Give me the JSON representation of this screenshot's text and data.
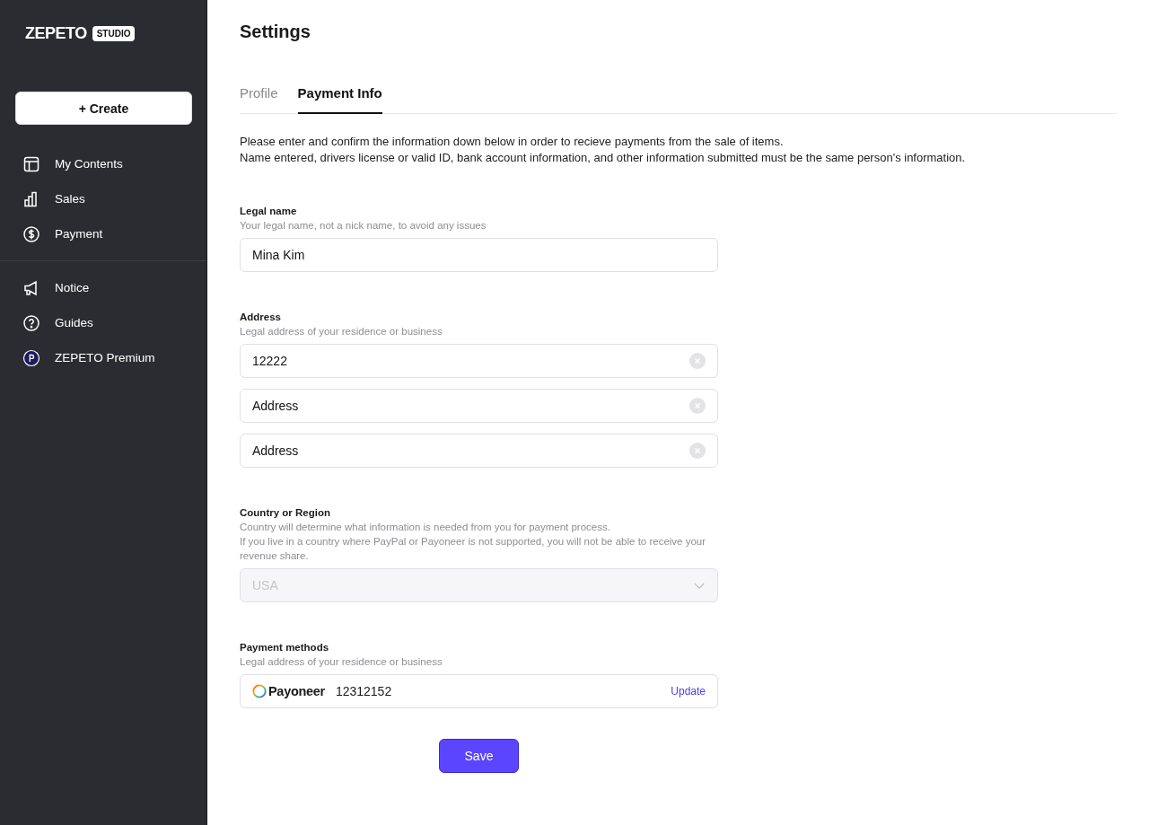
{
  "sidebar": {
    "logo": {
      "wordmark": "ZEPETO",
      "badge": "STUDIO"
    },
    "create_button": "+ Create",
    "groups": [
      [
        {
          "kind": "contents",
          "label": "My Contents"
        },
        {
          "kind": "sales",
          "label": "Sales"
        },
        {
          "kind": "payment",
          "label": "Payment"
        }
      ],
      [
        {
          "kind": "notice",
          "label": "Notice"
        },
        {
          "kind": "guides",
          "label": "Guides"
        },
        {
          "kind": "premium",
          "label": "ZEPETO Premium"
        }
      ]
    ]
  },
  "page": {
    "title": "Settings",
    "tabs": [
      {
        "label": "Profile",
        "selected": false
      },
      {
        "label": "Payment Info",
        "selected": true
      }
    ],
    "intro": [
      "Please enter and confirm the information down below in order to recieve payments from the sale of items.",
      "Name entered, drivers license or valid ID, bank account information, and other information submitted must be the same person's information."
    ],
    "legal_name": {
      "label": "Legal name",
      "hint": [
        "Your legal name, not a nick name, to avoid any issues"
      ],
      "value": "Mina Kim"
    },
    "address": {
      "label": "Address",
      "hint": [
        "Legal address of your residence or business"
      ],
      "fields": [
        {
          "value": "12222"
        },
        {
          "placeholder": "Address"
        },
        {
          "placeholder": "Address"
        }
      ]
    },
    "country": {
      "label": "Country or Region",
      "hint": [
        "Country will determine what information is needed from you for payment process.",
        "If you live in a country where PayPal or Payoneer is not supported, you will not be able to receive your revenue share."
      ],
      "value": "USA",
      "disabled": true
    },
    "payment_methods": {
      "label": "Payment methods",
      "hint": [
        "Legal address of your residence or business"
      ],
      "provider": "Payoneer",
      "account": "12312152",
      "action": "Update"
    },
    "save_button": "Save"
  }
}
